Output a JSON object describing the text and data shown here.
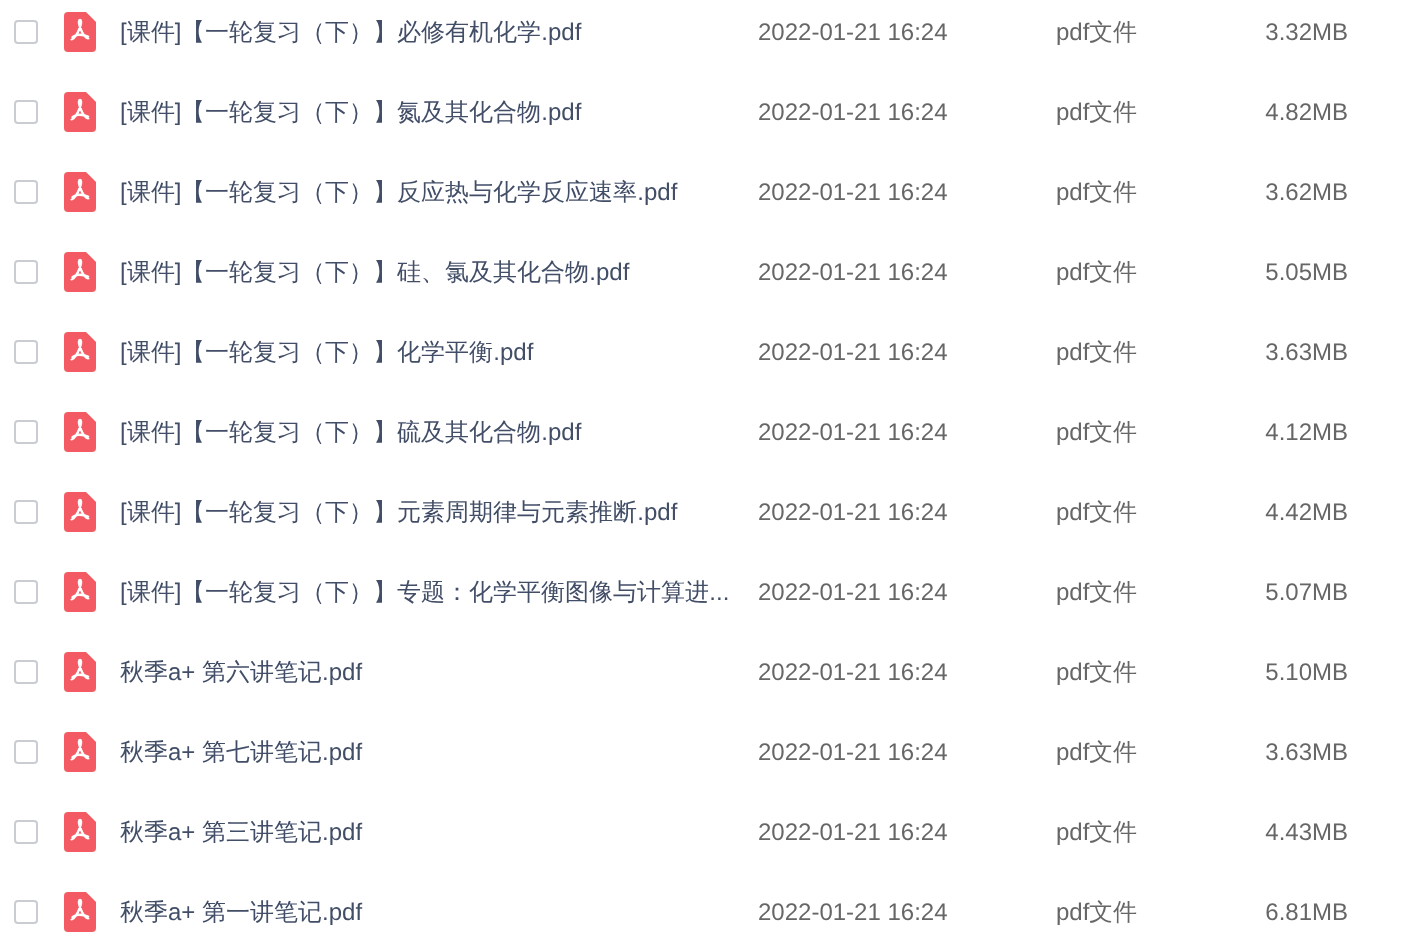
{
  "files": [
    {
      "name": "[课件]【一轮复习（下）】必修有机化学.pdf",
      "date": "2022-01-21 16:24",
      "type": "pdf文件",
      "size": "3.32MB",
      "checked": false
    },
    {
      "name": "[课件]【一轮复习（下）】氮及其化合物.pdf",
      "date": "2022-01-21 16:24",
      "type": "pdf文件",
      "size": "4.82MB",
      "checked": false
    },
    {
      "name": "[课件]【一轮复习（下）】反应热与化学反应速率.pdf",
      "date": "2022-01-21 16:24",
      "type": "pdf文件",
      "size": "3.62MB",
      "checked": false
    },
    {
      "name": "[课件]【一轮复习（下）】硅、氯及其化合物.pdf",
      "date": "2022-01-21 16:24",
      "type": "pdf文件",
      "size": "5.05MB",
      "checked": false
    },
    {
      "name": "[课件]【一轮复习（下）】化学平衡.pdf",
      "date": "2022-01-21 16:24",
      "type": "pdf文件",
      "size": "3.63MB",
      "checked": false
    },
    {
      "name": "[课件]【一轮复习（下）】硫及其化合物.pdf",
      "date": "2022-01-21 16:24",
      "type": "pdf文件",
      "size": "4.12MB",
      "checked": false
    },
    {
      "name": "[课件]【一轮复习（下）】元素周期律与元素推断.pdf",
      "date": "2022-01-21 16:24",
      "type": "pdf文件",
      "size": "4.42MB",
      "checked": false
    },
    {
      "name": "[课件]【一轮复习（下）】专题：化学平衡图像与计算进...",
      "date": "2022-01-21 16:24",
      "type": "pdf文件",
      "size": "5.07MB",
      "checked": false
    },
    {
      "name": "秋季a+ 第六讲笔记.pdf",
      "date": "2022-01-21 16:24",
      "type": "pdf文件",
      "size": "5.10MB",
      "checked": false
    },
    {
      "name": "秋季a+ 第七讲笔记.pdf",
      "date": "2022-01-21 16:24",
      "type": "pdf文件",
      "size": "3.63MB",
      "checked": false
    },
    {
      "name": "秋季a+ 第三讲笔记.pdf",
      "date": "2022-01-21 16:24",
      "type": "pdf文件",
      "size": "4.43MB",
      "checked": false
    },
    {
      "name": "秋季a+ 第一讲笔记.pdf",
      "date": "2022-01-21 16:24",
      "type": "pdf文件",
      "size": "6.81MB",
      "checked": false
    }
  ]
}
